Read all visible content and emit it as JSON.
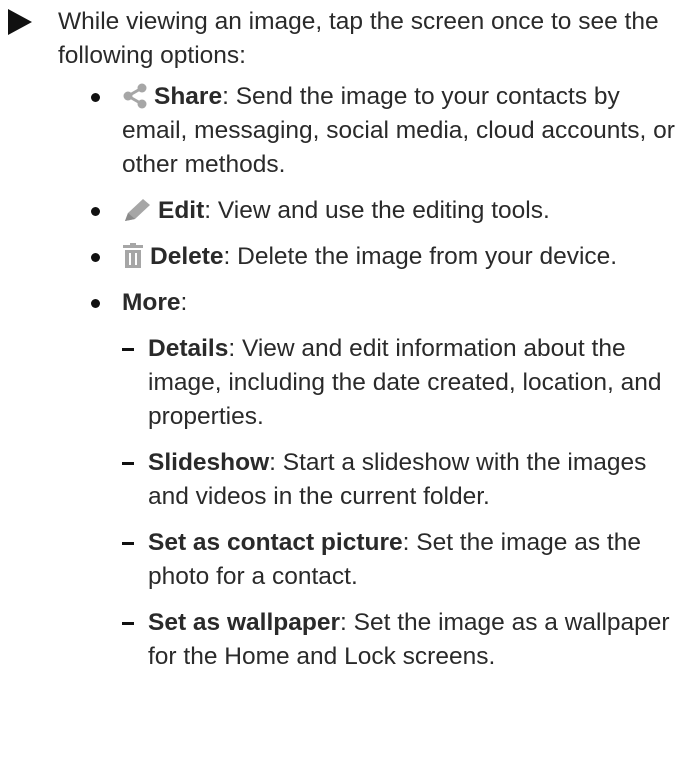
{
  "intro": {
    "text": "While viewing an image, tap the screen once to see the following options:"
  },
  "options": [
    {
      "icon": "share-icon",
      "label": "Share",
      "desc": ": Send the image to your contacts by email, messaging, social media, cloud accounts, or other methods."
    },
    {
      "icon": "pencil-icon",
      "label": "Edit",
      "desc": ": View and use the editing tools."
    },
    {
      "icon": "trash-icon",
      "label": "Delete",
      "desc": ": Delete the image from your device."
    },
    {
      "icon": "",
      "label": "More",
      "desc": ":"
    }
  ],
  "more_items": [
    {
      "label": "Details",
      "desc": ": View and edit information about the image, including the date created, location, and properties."
    },
    {
      "label": "Slideshow",
      "desc": ": Start a slideshow with the images and videos in the current folder."
    },
    {
      "label": "Set as contact picture",
      "desc": ": Set the image as the photo for a contact."
    },
    {
      "label": "Set as wallpaper",
      "desc": ": Set the image as a wallpaper for the Home and Lock screens."
    }
  ],
  "colors": {
    "text": "#2a2a2a",
    "icon_gray": "#a6a6a6",
    "bullet": "#111111"
  }
}
